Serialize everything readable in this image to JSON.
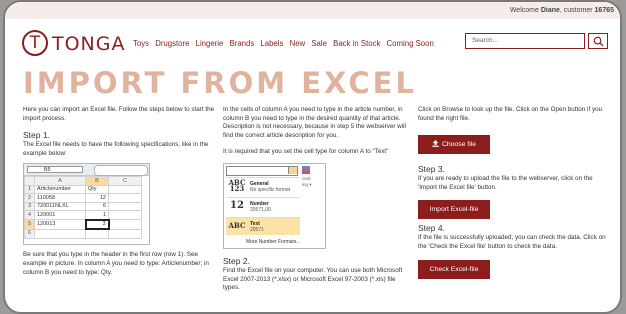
{
  "header": {
    "welcome_prefix": "Welcome ",
    "welcome_name": "Diane",
    "welcome_suffix": ", customer",
    "welcome_id": "16765",
    "logo_letter": "T",
    "logo_text": "TONGA",
    "nav": [
      "Toys",
      "Drugstore",
      "Lingerie",
      "Brands",
      "Labels",
      "New",
      "Sale",
      "Back in Stock",
      "Coming Soon"
    ],
    "search_placeholder": "Search..."
  },
  "page": {
    "title": "IMPORT FROM EXCEL"
  },
  "col1": {
    "intro": "Here you can import an Excel file. Follow the steps below to start the import process.",
    "step1_title": "Step 1.",
    "step1_text": "The Excel file needs to have the following specifications, like in the example below:",
    "excel": {
      "cell_ref": "B5",
      "col_headers": [
        "A",
        "B",
        "C"
      ],
      "rows": [
        [
          "1",
          "Articlenumber",
          "Qty"
        ],
        [
          "2",
          "110058",
          "12"
        ],
        [
          "3",
          "720011NLXL",
          "6"
        ],
        [
          "4",
          "120001",
          "1"
        ],
        [
          "5",
          "120013",
          "3"
        ],
        [
          "6",
          "",
          ""
        ]
      ]
    },
    "after_text": "Be sure that you type in the header in the first row (row 1). See example in picture. In column A you need to type: Articlenumber; in column B you need to type: Qty."
  },
  "col2": {
    "text1": "In the cells of column A you need to type in the article number, in column B you need to type in the desired quantity of that article. Description is not necessary, because in step 5 the webserver will find the correct article description for you.",
    "text2": "It is required that you set the cell type for column A to “Text”",
    "format_menu": {
      "items": [
        {
          "icon": "ABC 123",
          "name": "General",
          "sub": "No specific format"
        },
        {
          "icon": "12",
          "name": "Number",
          "sub": "20571,00"
        },
        {
          "icon": "ABC",
          "name": "Text",
          "sub": "20571"
        }
      ],
      "more": "More Number Formats...",
      "side_label_1": "onal",
      "side_label_2": "ing ▾"
    },
    "step2_title": "Step 2.",
    "step2_text": "Find the Excel file on your computer. You can use both Microsoft Excel 2007-2013 (*.xlsx) or Microsoft Excel 97-2003 (*.xls) file types."
  },
  "col3": {
    "browse_text": "Click on Browse to look up the file. Click on the Open button if you found the right file.",
    "choose_button": "Choose file",
    "step3_title": "Step 3.",
    "step3_text": "If you are ready to upload the file to the webserver, click on the 'Import the Excel file' button.",
    "import_button": "Import Excel-file",
    "step4_title": "Step 4.",
    "step4_text": "If the file is successfully uploaded, you can check the data. Click on the 'Check the Excel file' button to check the data.",
    "check_button": "Check Excel-file"
  },
  "colors": {
    "brand": "#8b1d1d",
    "title": "#e0b39f",
    "topbar": "#f6ece8"
  }
}
